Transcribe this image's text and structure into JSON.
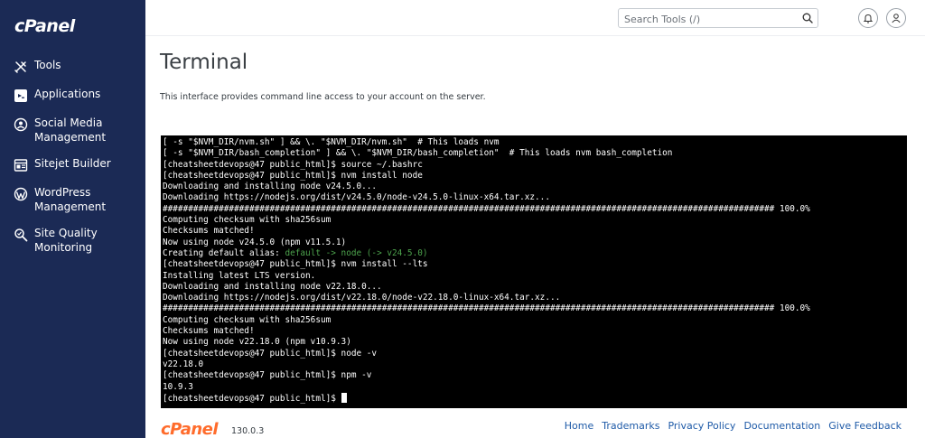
{
  "brand": {
    "logo_text": "cPanel",
    "accent_color": "#ff6c2c",
    "sidebar_color": "#1b2a55"
  },
  "sidebar": {
    "items": [
      {
        "label": "Tools",
        "icon": "tools-icon"
      },
      {
        "label": "Applications",
        "icon": "applications-icon"
      },
      {
        "label": "Social Media Management",
        "icon": "social-media-icon"
      },
      {
        "label": "Sitejet Builder",
        "icon": "sitejet-icon"
      },
      {
        "label": "WordPress Management",
        "icon": "wordpress-icon"
      },
      {
        "label": "Site Quality Monitoring",
        "icon": "site-quality-icon"
      }
    ]
  },
  "header": {
    "search_placeholder": "Search Tools (/)",
    "notifications_icon": "bell-icon",
    "user_icon": "user-icon"
  },
  "main": {
    "title": "Terminal",
    "description": "This interface provides command line access to your account on the server."
  },
  "terminal": {
    "lines": [
      "[ -s \"$NVM_DIR/nvm.sh\" ] && \\. \"$NVM_DIR/nvm.sh\"  # This loads nvm",
      "[ -s \"$NVM_DIR/bash_completion\" ] && \\. \"$NVM_DIR/bash_completion\"  # This loads nvm bash_completion",
      "[cheatsheetdevops@47 public_html]$ source ~/.bashrc",
      "[cheatsheetdevops@47 public_html]$ nvm install node",
      "Downloading and installing node v24.5.0...",
      "Downloading https://nodejs.org/dist/v24.5.0/node-v24.5.0-linux-x64.tar.xz...",
      "######################################################################################################################## 100.0%",
      "Computing checksum with sha256sum",
      "Checksums matched!",
      "Now using node v24.5.0 (npm v11.5.1)",
      "",
      "[cheatsheetdevops@47 public_html]$ nvm install --lts",
      "Installing latest LTS version.",
      "Downloading and installing node v22.18.0...",
      "Downloading https://nodejs.org/dist/v22.18.0/node-v22.18.0-linux-x64.tar.xz...",
      "######################################################################################################################## 100.0%",
      "Computing checksum with sha256sum",
      "Checksums matched!",
      "Now using node v22.18.0 (npm v10.9.3)",
      "[cheatsheetdevops@47 public_html]$ node -v",
      "v22.18.0",
      "[cheatsheetdevops@47 public_html]$ npm -v",
      "10.9.3",
      "[cheatsheetdevops@47 public_html]$ "
    ],
    "alias_prefix": "Creating default alias: ",
    "alias_highlight": "default -> node (-> v24.5.0)",
    "highlight_color": "#4da34d"
  },
  "footer": {
    "logo_text": "cPanel",
    "version": "130.0.3",
    "links": [
      "Home",
      "Trademarks",
      "Privacy Policy",
      "Documentation",
      "Give Feedback"
    ]
  }
}
